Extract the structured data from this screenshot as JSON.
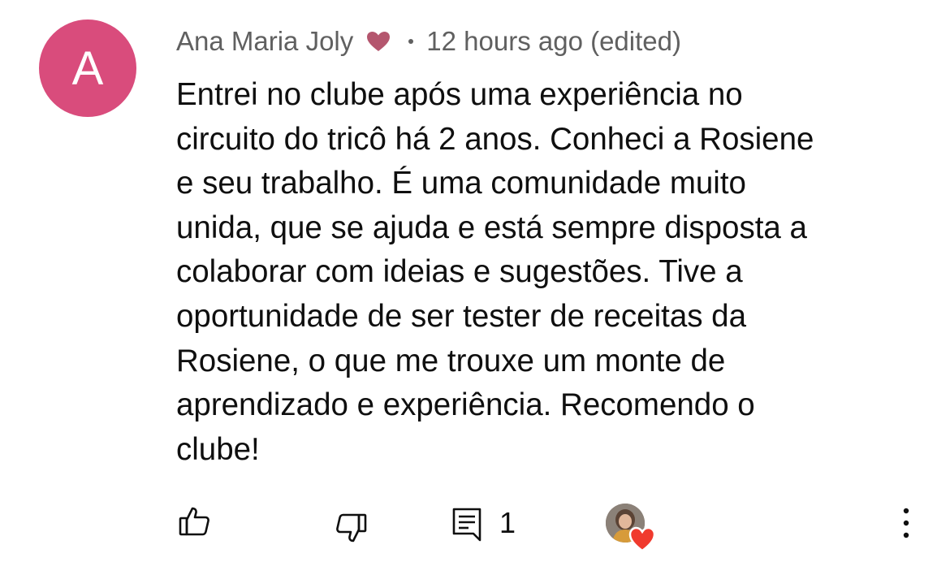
{
  "comment": {
    "avatar_initial": "A",
    "author": "Ana Maria Joly",
    "author_badge_icon": "heart-icon",
    "timestamp": "12 hours ago (edited)",
    "text": "Entrei no clube após uma experiência no\ncircuito do tricô há 2 anos. Conheci a Rosiene\ne seu trabalho. É uma comunidade muito\nunida, que se ajuda e está sempre disposta a\ncolaborar com ideias e sugestões.  Tive a\noportunidade de ser tester de receitas da\nRosiene, o que me trouxe um monte de\naprendizado e experiência. Recomendo o\nclube!",
    "reply_count": "1"
  },
  "colors": {
    "avatar_bg": "#d94c7c",
    "meta_text": "#606060",
    "body_text": "#0f0f0f",
    "heart_red": "#f03a2e",
    "heart_muted": "#b4566e"
  },
  "icons": {
    "like": "thumbs-up-icon",
    "dislike": "thumbs-down-icon",
    "reply": "comment-icon",
    "creator_heart": "creator-heart-icon",
    "more": "more-vertical-icon"
  }
}
